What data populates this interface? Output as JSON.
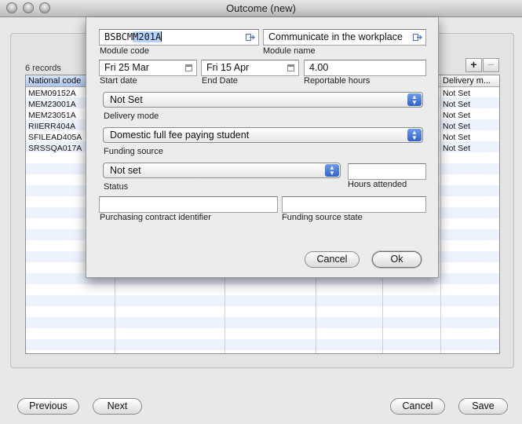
{
  "window": {
    "title": "Outcome (new)"
  },
  "main": {
    "records_count": "6 records",
    "add_label": "+",
    "remove_label": "−",
    "table": {
      "columns": [
        "National code",
        "Delivery m..."
      ],
      "rows": [
        {
          "code": "MEM09152A",
          "delivery": "Not Set"
        },
        {
          "code": "MEM23001A",
          "delivery": "Not Set"
        },
        {
          "code": "MEM23051A",
          "delivery": "Not Set"
        },
        {
          "code": "RIIERR404A",
          "delivery": "Not Set"
        },
        {
          "code": "SFILEAD405A",
          "delivery": "Not Set"
        },
        {
          "code": "SRSSQA017A",
          "delivery": "Not Set"
        }
      ]
    },
    "buttons": {
      "previous": "Previous",
      "next": "Next",
      "cancel": "Cancel",
      "save": "Save"
    }
  },
  "sheet": {
    "module_code": {
      "value_plain": "BSBCM",
      "value_selected": "M201A",
      "label": "Module code"
    },
    "module_name": {
      "value": "Communicate in the workplace",
      "label": "Module name"
    },
    "start_date": {
      "value": "Fri 25 Mar",
      "label": "Start date"
    },
    "end_date": {
      "value": "Fri 15 Apr",
      "label": "End Date"
    },
    "reportable_hours": {
      "value": "4.00",
      "label": "Reportable hours"
    },
    "delivery_mode": {
      "value": "Not Set",
      "label": "Delivery mode"
    },
    "funding_source": {
      "value": "Domestic full fee paying student",
      "label": "Funding source"
    },
    "status": {
      "value": "Not set",
      "label": "Status"
    },
    "hours_attended": {
      "value": "",
      "label": "Hours attended"
    },
    "purchasing_contract": {
      "value": "",
      "label": "Purchasing contract identifier"
    },
    "funding_source_state": {
      "value": "",
      "label": "Funding source state"
    },
    "buttons": {
      "cancel": "Cancel",
      "ok": "Ok"
    }
  },
  "colors": {
    "selection": "#b5d3ff",
    "popup_arrow": "#2f61c9",
    "row_stripe": "#edf3fe"
  },
  "icons": [
    "window-close-icon",
    "window-minimize-icon",
    "window-zoom-icon",
    "link-arrow-icon",
    "calendar-icon",
    "popup-arrows-icon"
  ]
}
